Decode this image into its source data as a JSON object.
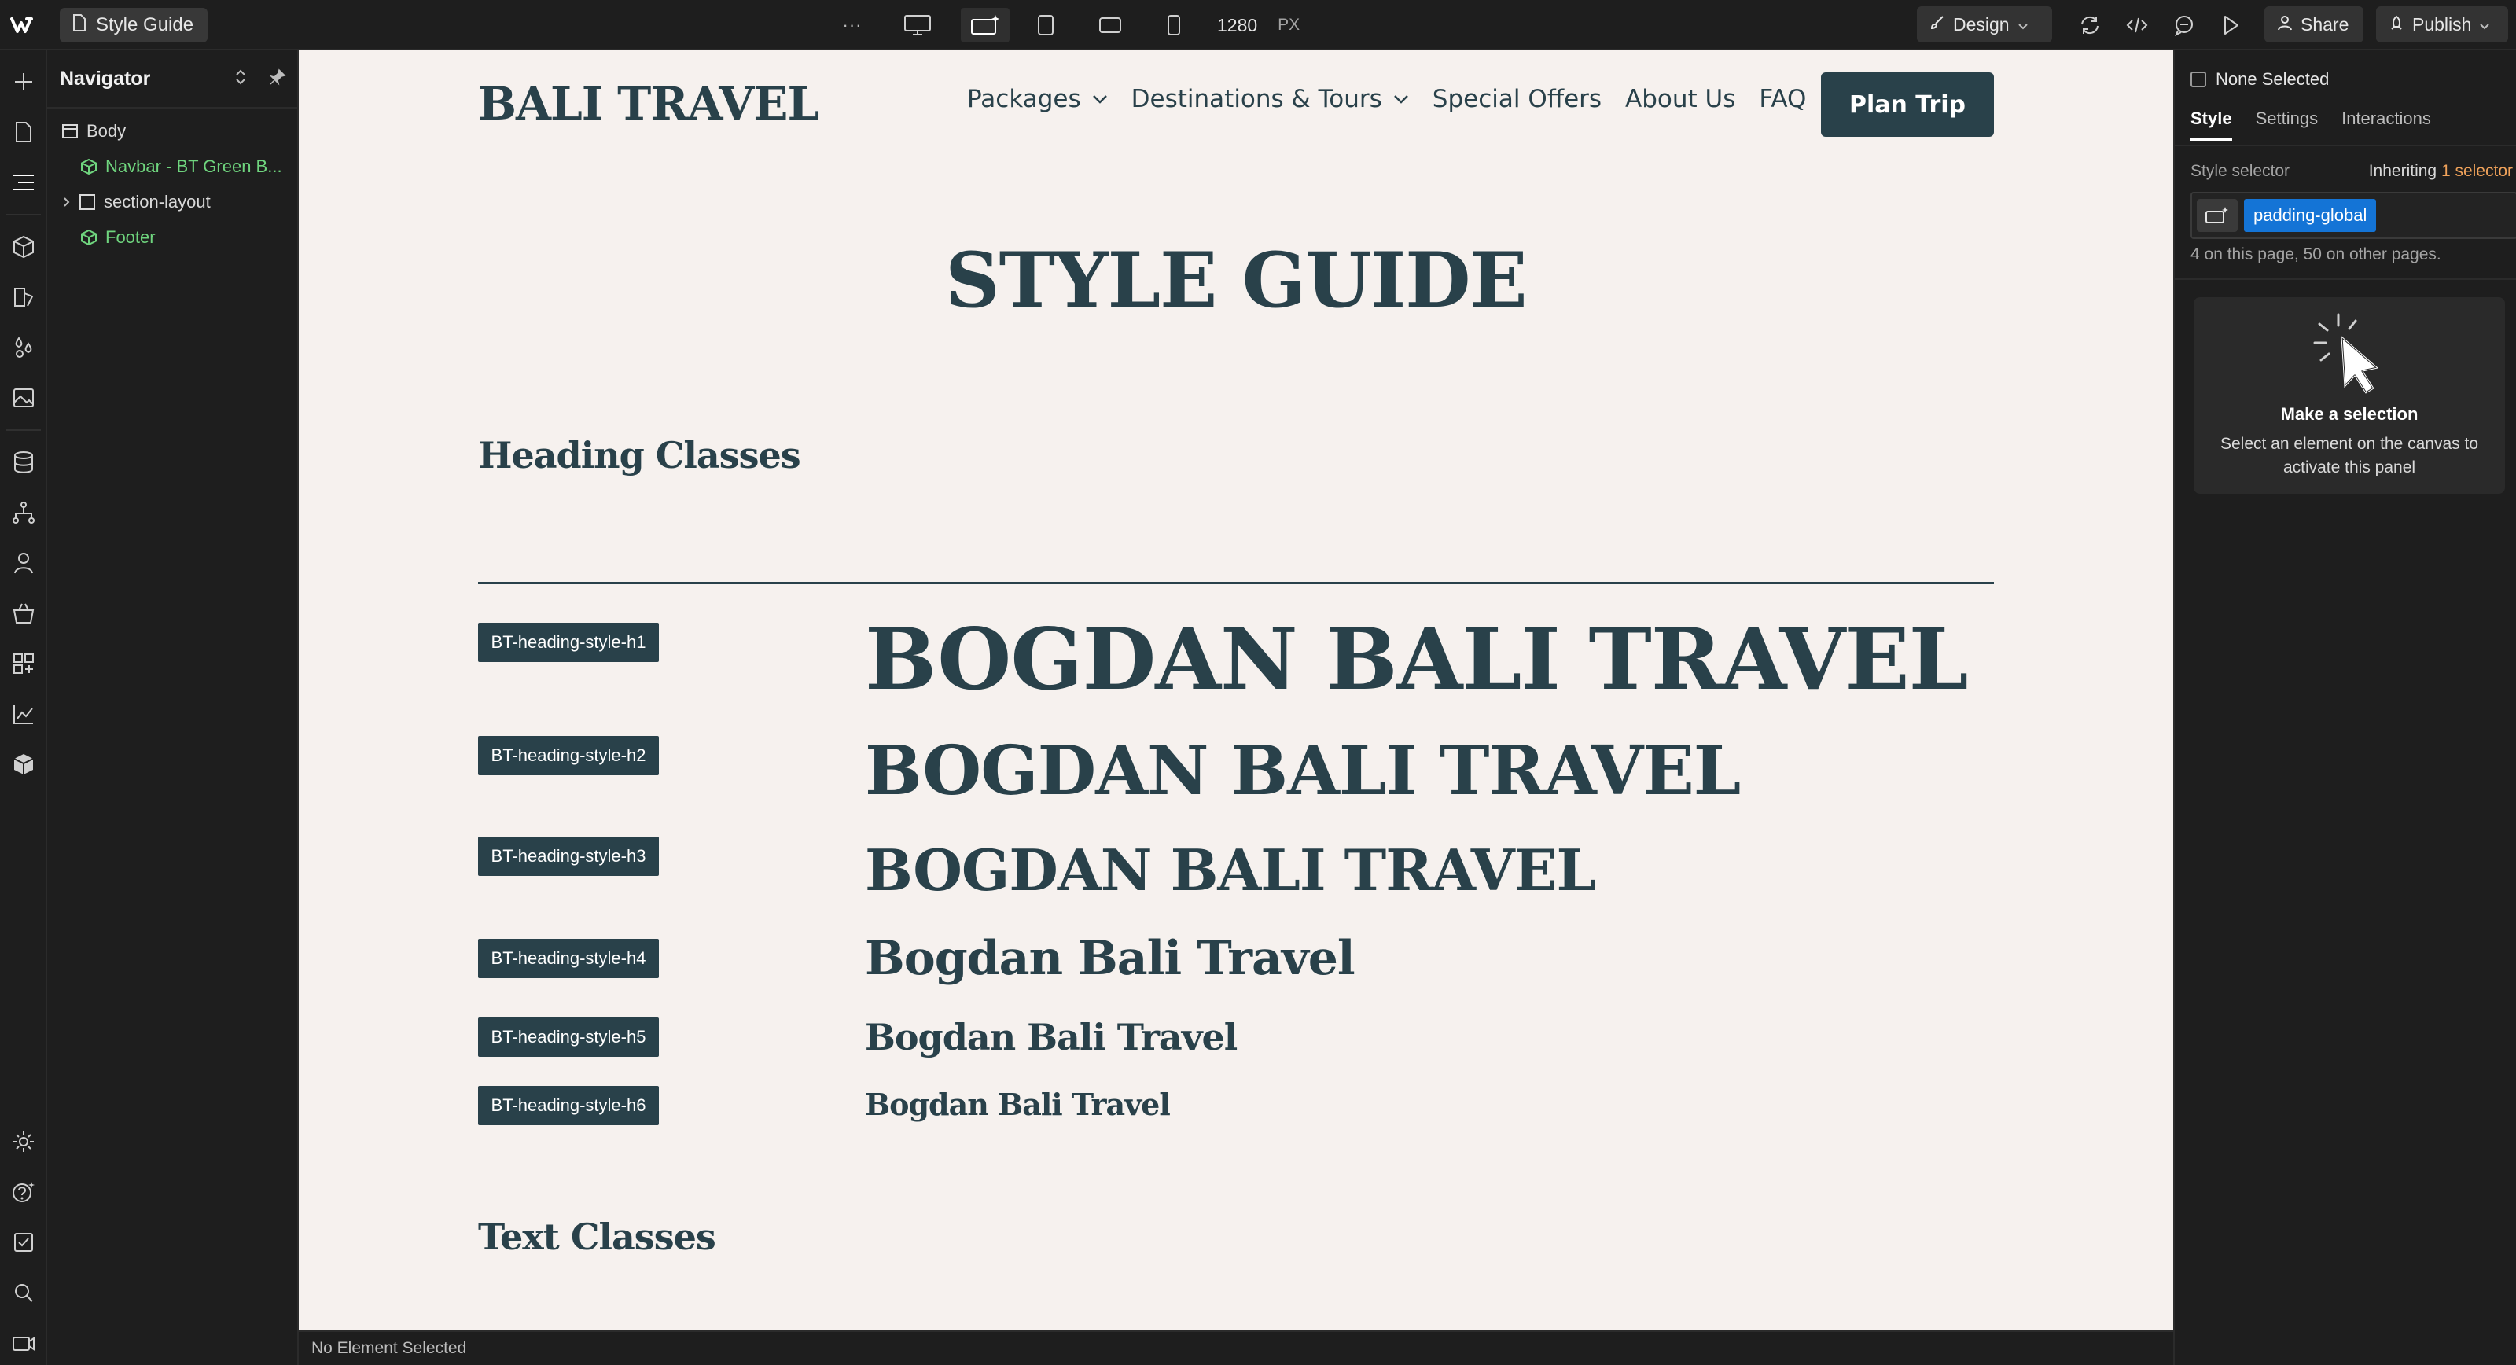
{
  "topbar": {
    "page_name": "Style Guide",
    "more_glyph": "···",
    "canvas_width": "1280",
    "canvas_unit": "PX",
    "design_label": "Design",
    "share_label": "Share",
    "publish_label": "Publish"
  },
  "navigator": {
    "title": "Navigator",
    "items": [
      {
        "label": "Body"
      },
      {
        "label": "Navbar - BT Green B..."
      },
      {
        "label": "section-layout"
      },
      {
        "label": "Footer"
      }
    ]
  },
  "site": {
    "logo": "BALI TRAVEL",
    "nav": [
      "Packages",
      "Destinations & Tours",
      "Special Offers",
      "About Us",
      "FAQ"
    ],
    "cta": "Plan Trip",
    "page_title": "STYLE GUIDE",
    "section_heading_classes": "Heading Classes",
    "section_text_classes": "Text Classes",
    "headings": [
      {
        "class_name": "BT-heading-style-h1",
        "sample": "BOGDAN BALI TRAVEL"
      },
      {
        "class_name": "BT-heading-style-h2",
        "sample": "BOGDAN BALI TRAVEL"
      },
      {
        "class_name": "BT-heading-style-h3",
        "sample": "BOGDAN BALI TRAVEL"
      },
      {
        "class_name": "BT-heading-style-h4",
        "sample": "Bogdan Bali Travel"
      },
      {
        "class_name": "BT-heading-style-h5",
        "sample": "Bogdan Bali Travel"
      },
      {
        "class_name": "BT-heading-style-h6",
        "sample": "Bogdan Bali Travel"
      }
    ]
  },
  "statusbar": {
    "text": "No Element Selected"
  },
  "style_panel": {
    "none_selected": "None Selected",
    "tabs": [
      "Style",
      "Settings",
      "Interactions"
    ],
    "style_selector_label": "Style selector",
    "inheriting_prefix": "Inheriting",
    "inheriting_count": "1 selector",
    "selector_chip": "padding-global",
    "usage_text": "4 on this page, 50 on other pages.",
    "empty_title": "Make a selection",
    "empty_text": "Select an element on the canvas to activate this panel"
  },
  "colors": {
    "brand_dark": "#29414a",
    "canvas_bg": "#f6f1ee",
    "editor_bg": "#1e1e1e",
    "selector_blue": "#1474d6",
    "symbol_green": "#6fd57e",
    "accent_orange": "#f0a25a"
  },
  "icons": [
    "webflow-logo-icon",
    "page-icon",
    "more-icon",
    "desktop-icon",
    "desktop-star-icon",
    "tablet-icon",
    "tablet-landscape-icon",
    "mobile-icon",
    "brush-icon",
    "chevron-down-icon",
    "sync-icon",
    "code-icon",
    "comment-icon",
    "play-icon",
    "user-icon",
    "rocket-icon",
    "plus-icon",
    "pages-icon",
    "navigator-icon",
    "components-icon",
    "variables-icon",
    "styles-icon",
    "assets-icon",
    "cms-icon",
    "logic-icon",
    "users-icon",
    "ecommerce-icon",
    "apps-icon",
    "insights-icon",
    "libraries-icon",
    "settings-icon",
    "help-icon",
    "audit-icon",
    "search-icon",
    "video-icon",
    "sort-icon",
    "pin-icon",
    "box-icon",
    "symbol-icon",
    "cursor-click-icon"
  ]
}
